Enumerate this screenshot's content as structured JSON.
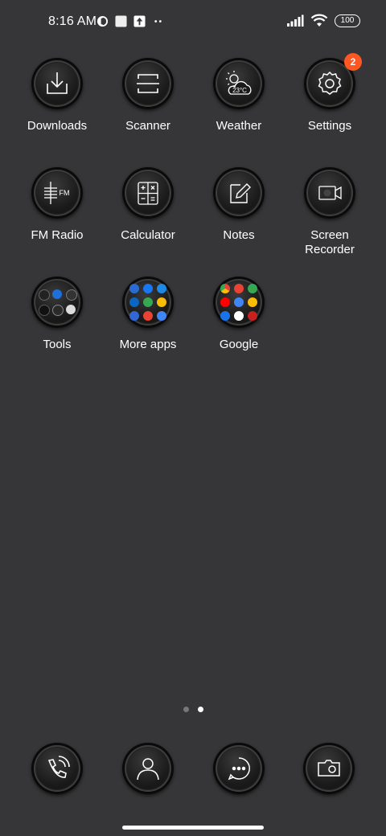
{
  "status": {
    "time": "8:16 AM",
    "battery": "100"
  },
  "apps": {
    "downloads": "Downloads",
    "scanner": "Scanner",
    "weather": "Weather",
    "weather_temp": "23°C",
    "settings": "Settings",
    "settings_badge": "2",
    "fm_radio": "FM Radio",
    "fm_text": "FM",
    "calculator": "Calculator",
    "notes": "Notes",
    "screen_recorder_line1": "Screen",
    "screen_recorder_line2": "Recorder",
    "tools": "Tools",
    "more_apps": "More apps",
    "google": "Google"
  },
  "pages": {
    "count": 2,
    "active": 2
  },
  "icons": {
    "downloads": "download-icon",
    "scanner": "scanner-icon",
    "weather": "weather-icon",
    "settings": "gear-icon",
    "fm_radio": "radio-icon",
    "calculator": "calculator-icon",
    "notes": "notes-icon",
    "screen_recorder": "video-camera-icon",
    "dock": [
      "phone-icon",
      "contacts-icon",
      "messages-icon",
      "camera-icon"
    ]
  },
  "colors": {
    "background": "#363638",
    "badge": "#ff5722",
    "accent_text": "#ffffff"
  }
}
